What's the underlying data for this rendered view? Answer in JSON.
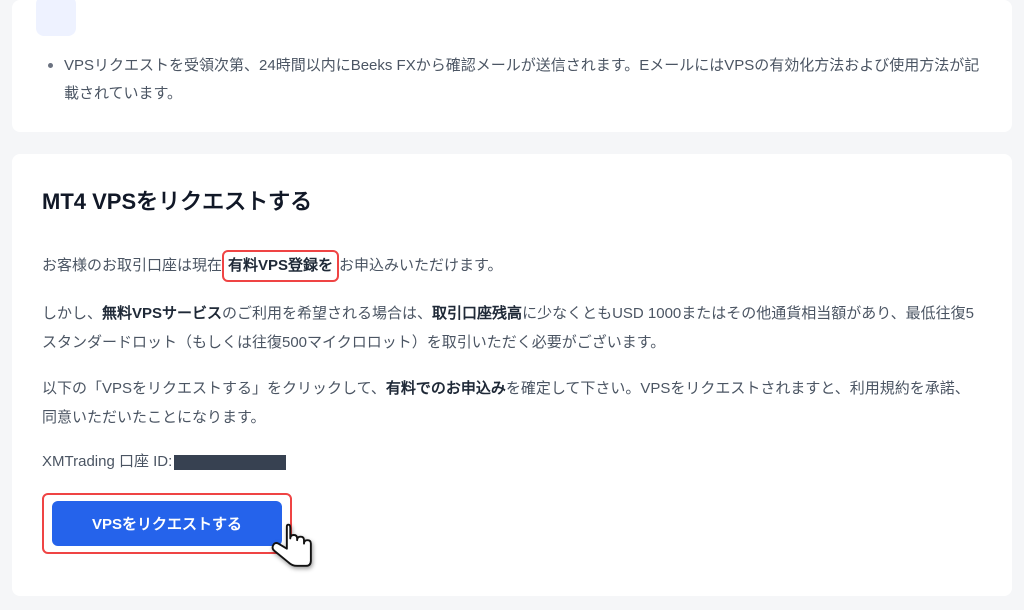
{
  "card1": {
    "bullet1": "VPSリクエストを受領次第、24時間以内にBeeks FXから確認メールが送信されます。EメールにはVPSの有効化方法および使用方法が記載されています。"
  },
  "card2": {
    "title": "MT4 VPSをリクエストする",
    "p1_pre": "お客様のお取引口座は現在",
    "p1_box": "有料VPS登録を",
    "p1_post": "お申込みいただけます。",
    "p2_a": "しかし、",
    "p2_b_bold": "無料VPSサービス",
    "p2_c": "のご利用を希望される場合は、",
    "p2_d_bold": "取引口座残高",
    "p2_e": "に少なくともUSD 1000またはその他通貨相当額があり、最低往復5スタンダードロット（もしくは往復500マイクロロット）を取引いただく必要がございます。",
    "p3_a": "以下の「VPSをリクエストする」をクリックして、",
    "p3_b_bold": "有料でのお申込み",
    "p3_c": "を確定して下さい。VPSをリクエストされますと、利用規約を承諾、同意いただいたことになります。",
    "account_label": "XMTrading 口座 ID:",
    "button_label": "VPSをリクエストする"
  }
}
